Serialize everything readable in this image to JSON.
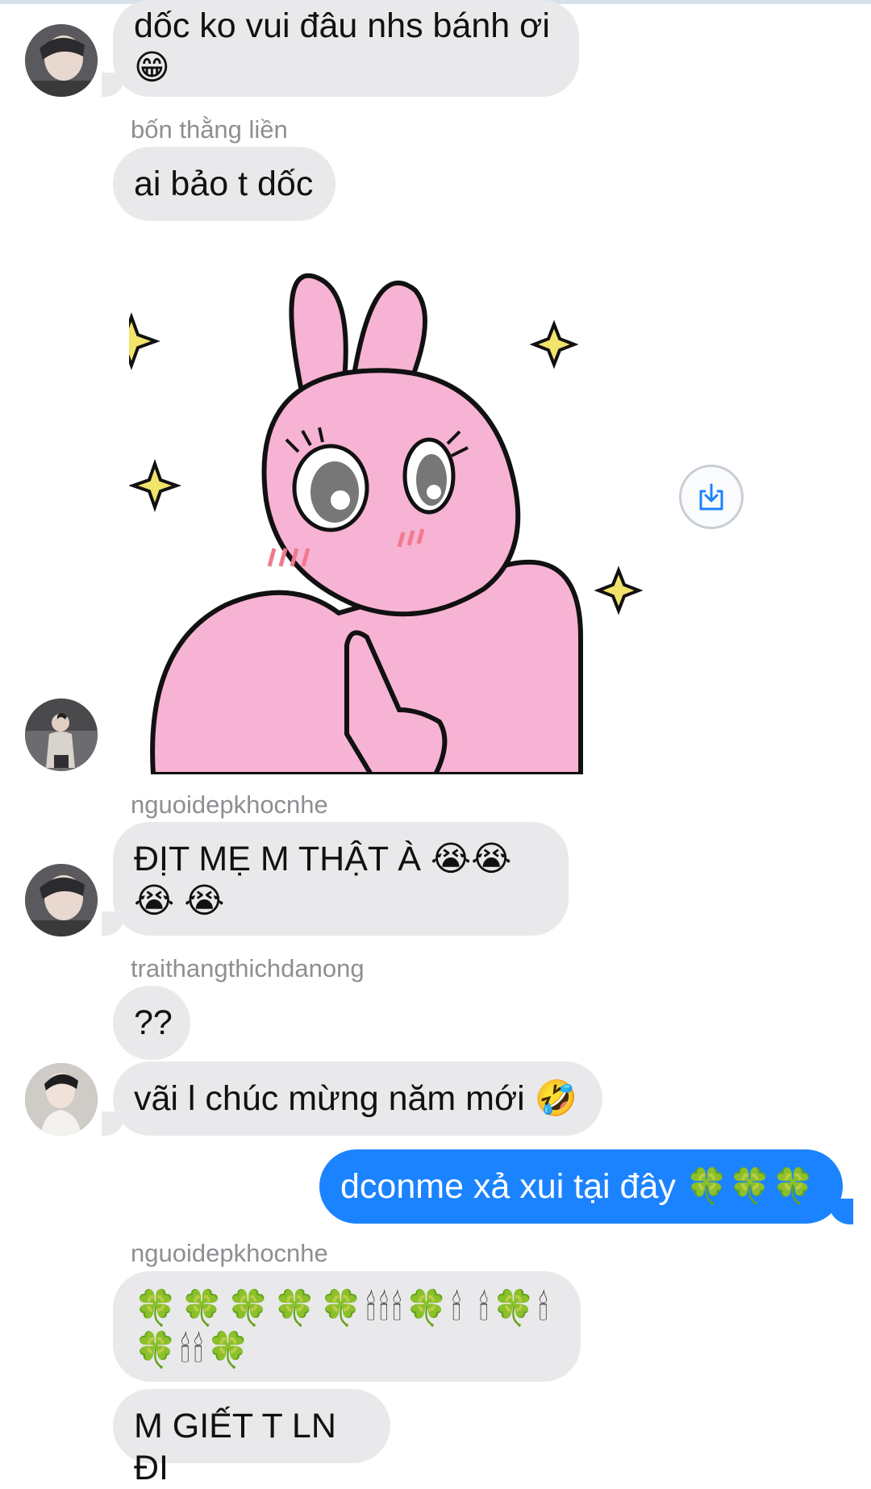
{
  "messages": {
    "m1": {
      "text": "dốc ko vui đâu nhs bánh ơi 😁"
    },
    "m2": {
      "sender": "bốn thằng liền",
      "text": "ai bảo t dốc"
    },
    "m4": {
      "sender": "nguoidepkhocnhe",
      "text": "ĐỊT MẸ M THẬT À 😭😭😭 😭"
    },
    "m5": {
      "sender": "traithangthichdanong",
      "text": "??"
    },
    "m6": {
      "text": "vãi l chúc mừng năm mới 🤣"
    },
    "m7": {
      "text": "dconme xả xui tại đây 🍀🍀🍀"
    },
    "m8": {
      "sender": "nguoidepkhocnhe",
      "text": "🍀🍀🍀🍀🍀🕯🕯🕯🍀🕯 🕯🍀🕯🍀🕯🕯🍀"
    },
    "m9": {
      "text": "M GIẾT T LN ĐI"
    }
  },
  "colors": {
    "incoming_bubble": "#e9e9eb",
    "outgoing_bubble": "#1b83ff",
    "sender_name": "#8e8e93",
    "sticker_pink": "#f7b3d3"
  },
  "icons": {
    "sticker": "pink-bunny-sticker",
    "save": "save-download-icon"
  }
}
